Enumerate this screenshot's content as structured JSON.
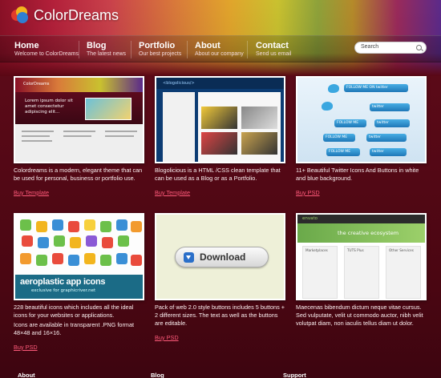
{
  "brand": {
    "name": "ColorDreams"
  },
  "nav": {
    "items": [
      {
        "label": "Home",
        "sub": "Welcome to ColorDreams"
      },
      {
        "label": "Blog",
        "sub": "The latest news"
      },
      {
        "label": "Portfolio",
        "sub": "Our best projects"
      },
      {
        "label": "About",
        "sub": "About our company"
      },
      {
        "label": "Contact",
        "sub": "Send us email"
      }
    ],
    "search_placeholder": "Search"
  },
  "cards": [
    {
      "desc": "Colordreams is a modern, elegant theme that can be used for personal, business or portfolio use.",
      "link": "Buy Template",
      "thumb": {
        "logo": "ColorDreams",
        "headline": "Lorem ipsum dolor sit amet consectetur adipiscing elit..."
      }
    },
    {
      "desc": "Blogolicious is a HTML /CSS clean template that can be used as a Blog or as a Portfolio.",
      "link": "Buy Template",
      "thumb": {
        "logo": "<blogolicious/>"
      }
    },
    {
      "desc": "11+ Beautiful Twitter Icons And Buttons in white and blue background.",
      "link": "Buy PSD",
      "thumb": {
        "buttons": [
          "FOLLOW ME ON twitter",
          "twitter",
          "FOLLOW ME",
          "twitter",
          "FOLLOW ME",
          "twitter",
          "FOLLOW ME",
          "twitter"
        ]
      }
    },
    {
      "desc": "228 beautiful icons which includes all the ideal icons for your websites or applications.",
      "desc2": "Icons are available in transparent .PNG format 48×48 and 16×16.",
      "link": "Buy PSD",
      "thumb": {
        "title": "aeroplastic app icons",
        "sub": "exclusive for graphicriver.net"
      }
    },
    {
      "desc": "Pack of web 2.0 style buttons includes 5 buttons + 2 different sizes. The text as well as the buttons are editable.",
      "link": "Buy PSD",
      "thumb": {
        "button": "Download"
      }
    },
    {
      "desc": "Maecenas bibendum dictum neque vitae cursus. Sed vulputate, velit ut commodo auctor, nibh velit volutpat diam, non iaculis tellus diam ut dolor.",
      "link": "",
      "thumb": {
        "logo": "envato",
        "tagline": "the creative ecosystem",
        "columns": [
          "Marketplaces",
          "TUTS Plus",
          "Other Services"
        ]
      }
    }
  ],
  "footer": {
    "columns": [
      "About",
      "Blog",
      "Support"
    ]
  }
}
